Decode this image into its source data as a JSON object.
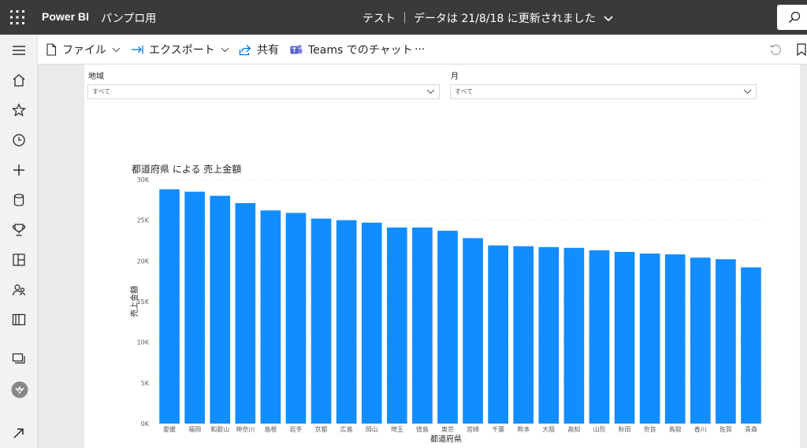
{
  "app": {
    "brand": "Power BI",
    "workspace": "パンプロ用",
    "report_title": "テスト ｜ データは 21/8/18 に更新されました"
  },
  "toolbar": {
    "file_label": "ファイル",
    "export_label": "エクスポート",
    "share_label": "共有",
    "teams_label": "Teams でのチャット",
    "more_label": "···"
  },
  "colors": {
    "topbar": "#3b3a39",
    "bar": "#118dff",
    "teams": "#5b5fc7",
    "export": "#0078d4"
  },
  "nav_icons": [
    "menu-icon",
    "home-icon",
    "favorites-icon",
    "recent-icon",
    "create-icon",
    "datasets-icon",
    "goals-icon",
    "apps-icon",
    "shared-icon",
    "learn-icon",
    "workspaces-icon",
    "my-workspace-icon",
    "expand-icon"
  ],
  "slicers": [
    {
      "label": "地域",
      "value": "すべて"
    },
    {
      "label": "月",
      "value": "すべて"
    }
  ],
  "chart_data": {
    "type": "bar",
    "title": "都道府県 による 売上金額",
    "xlabel": "都道府県",
    "ylabel": "売上金額",
    "ylim": [
      0,
      30000
    ],
    "yticks": [
      "0K",
      "5K",
      "10K",
      "15K",
      "20K",
      "25K",
      "30K"
    ],
    "grid": true,
    "categories": [
      "愛媛",
      "福岡",
      "和歌山",
      "神奈川",
      "島根",
      "岩手",
      "京都",
      "広島",
      "岡山",
      "埼玉",
      "徳島",
      "東京",
      "宮崎",
      "千葉",
      "熊本",
      "大阪",
      "高知",
      "山形",
      "秋田",
      "奈良",
      "鳥取",
      "香川",
      "佐賀",
      "青森"
    ],
    "values": [
      28800,
      28500,
      28000,
      27100,
      26200,
      25900,
      25200,
      25000,
      24700,
      24100,
      24100,
      23700,
      22800,
      21900,
      21800,
      21700,
      21600,
      21300,
      21100,
      20900,
      20800,
      20400,
      20200,
      19200
    ],
    "color": "#118dff"
  }
}
